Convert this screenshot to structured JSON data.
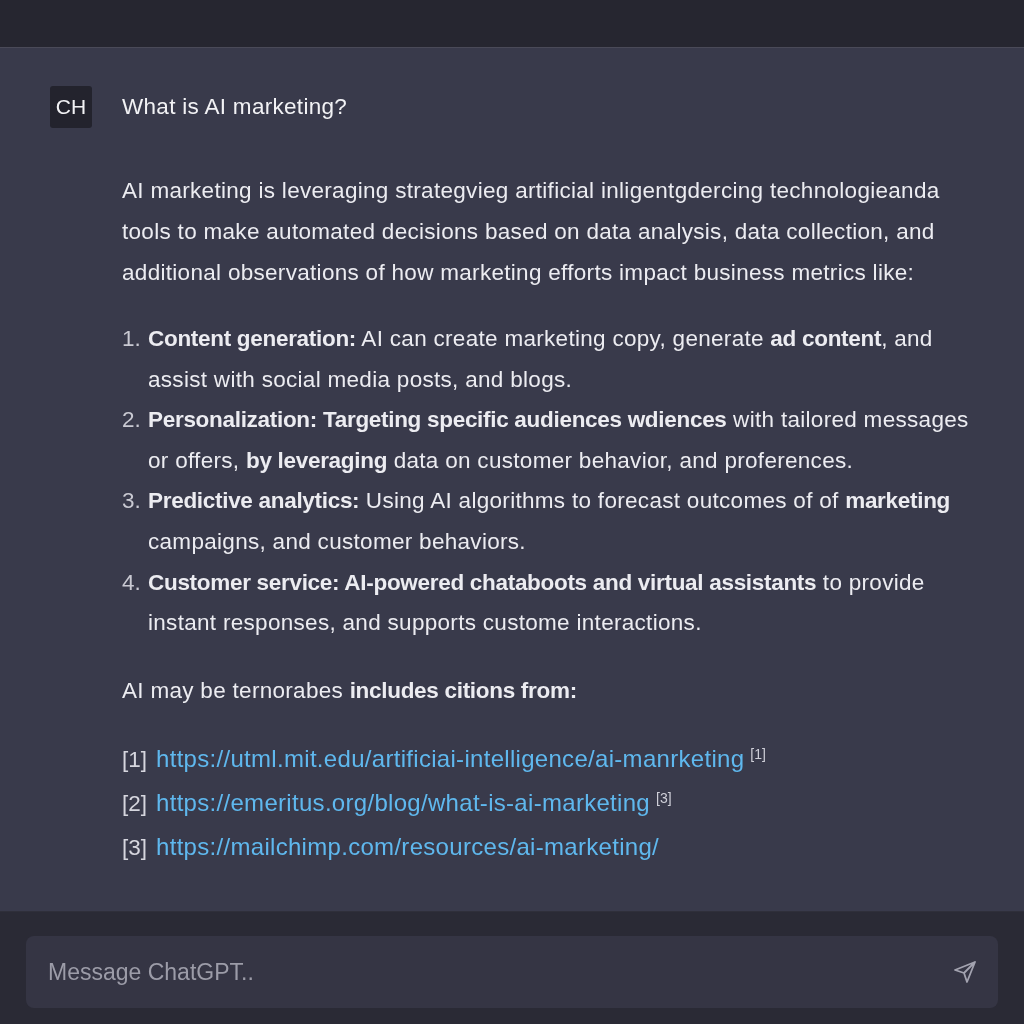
{
  "question": {
    "avatar": "CH",
    "text": "What is AI marketing?"
  },
  "answer": {
    "intro": "AI marketing is leveraging strategvieg artificial inligentgdercing technologieanda tools to make automated decisions based on data analysis, data collection, and additional observations of how marketing efforts impact business metrics like:",
    "items": [
      {
        "number": "1.",
        "text": "**Content generation:** AI can create marketing copy, generate **ad content**, and assist with social media posts, and blogs."
      },
      {
        "number": "2.",
        "text": "**Personalization: Targeting specific audiences wdiences** with tailored messages or offers, **by leveraging** data on customer behavior, and proferences."
      },
      {
        "number": "3.",
        "text": "**Predictive analytics:** Using AI algorithms to forecast outcomes of of **marketing** campaigns, and customer behaviors."
      },
      {
        "number": "4.",
        "text": "**Customer service: AI-powered chataboots and virtual assistants** to provide instant responses, and supports custome interactions."
      }
    ],
    "note": "AI may be ternorabes **includes citions from:**",
    "citations": [
      {
        "label": "[1]",
        "url": "https://utml.mit.edu/artificiai-intelligence/ai-manrketing",
        "ref": "[1]"
      },
      {
        "label": "[2]",
        "url": "https://emeritus.org/blog/what-is-ai-marketing",
        "ref": "[3]"
      },
      {
        "label": "[3]",
        "url": "https://mailchimp.com/resources/ai-marketing/"
      }
    ]
  },
  "composer": {
    "placeholder": "Message ChatGPT.."
  }
}
